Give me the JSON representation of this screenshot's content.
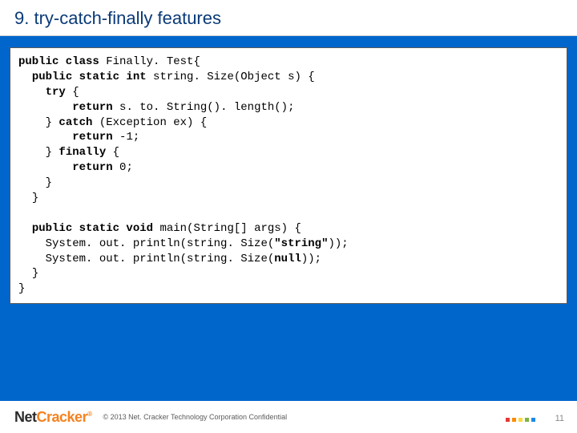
{
  "slide": {
    "title": "9. try-catch-finally features",
    "page_number": "11"
  },
  "code": {
    "l1a": "public class",
    "l1b": " Finally. Test{",
    "l2a": "public static int",
    "l2b": " string. Size(Object s) {",
    "l3a": "try",
    "l3b": " {",
    "l4a": "return",
    "l4b": " s. to. String(). length();",
    "l5a": "} ",
    "l5b": "catch",
    "l5c": " (Exception ex) {",
    "l6a": "return",
    "l6b": " -1;",
    "l7a": "} ",
    "l7b": "finally",
    "l7c": " {",
    "l8a": "return",
    "l8b": " 0;",
    "l9": "}",
    "l10": "}",
    "blank": "",
    "m1a": "public static void",
    "m1b": " main(String[] args) {",
    "m2a": "System. out. println(string. Size(",
    "m2b": "\"string\"",
    "m2c": "));",
    "m3a": "System. out. println(string. Size(",
    "m3b": "null",
    "m3c": "));",
    "m4": "}",
    "end": "}"
  },
  "footer": {
    "logo_part1": "Net",
    "logo_part2": "Cracker",
    "tm": "®",
    "copyright": "© 2013 Net. Cracker Technology Corporation Confidential"
  },
  "colors": {
    "dots": [
      "#e53935",
      "#fb8c00",
      "#fdd835",
      "#7cb342",
      "#1e88e5"
    ]
  }
}
